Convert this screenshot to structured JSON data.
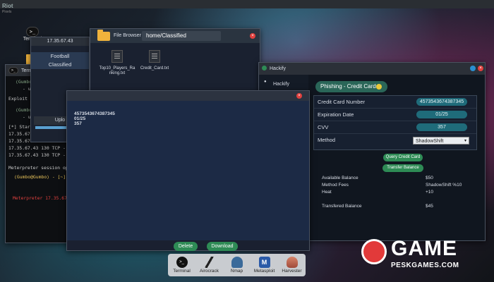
{
  "desktop": {
    "watermark_top": "Riot",
    "watermark_sub": "Pixels",
    "icons": [
      {
        "label": "Terminal"
      },
      {
        "label": "Terminal"
      }
    ]
  },
  "terminal": {
    "title": "Terminal",
    "lines": [
      "(Gumbo",
      "- use -x E",
      "Exploit not ava",
      "(Gumbo",
      "- use -x E",
      "[*] Started EternalBlue revers",
      "17.35.67.43 130 TCP - Built",
      "17.35.67.43 130 TCP - Overa",
      "17.35.67.43 130 TCP - Selec",
      "17.35.67.43 130 TCP - Exec",
      "Meterpreter session opened (",
      "(Gumbo@Gumbo) - [~]",
      "Meterpreter 17.35.67"
    ]
  },
  "ip_panel": {
    "ip": "17.35.67.43",
    "items": [
      "Football",
      "Classified"
    ],
    "upload_label": "Uplo"
  },
  "file_browser": {
    "title": "File Browser",
    "path": "home/Classified",
    "files": [
      {
        "name": "Top10_Players_Ra nking.txt"
      },
      {
        "name": "Credit_Card.txt"
      }
    ]
  },
  "hackify": {
    "title": "Hackify",
    "sidebar_item": "Hackify",
    "tab": "Phishing - Credit Cards",
    "form": {
      "rows": [
        {
          "label": "Credit Card Number",
          "value": "4573543674387345"
        },
        {
          "label": "Expiration Date",
          "value": "01/25"
        },
        {
          "label": "CVV",
          "value": "357"
        }
      ],
      "method_label": "Method",
      "method_value": "ShadowShift"
    },
    "buttons": {
      "query": "Query Credit Card",
      "transfer": "Transfer Balance"
    },
    "stats": {
      "available_label": "Available Balance",
      "available_value": "$50",
      "fees_label": "Method Fees",
      "fees_value": "ShadowShift %10",
      "heat_label": "Heat",
      "heat_value": "+10",
      "transferred_label": "Transfered Balance",
      "transferred_value": "$45"
    }
  },
  "message": {
    "lines": [
      "4573543674387345",
      "01/25",
      "357"
    ],
    "delete_label": "Delete",
    "download_label": "Download"
  },
  "dock": {
    "items": [
      "Terminal",
      "Airocrack",
      "Nmap",
      "Metasploit",
      "Harvester"
    ]
  },
  "game_watermark": {
    "brand": "GAME",
    "site": "PESKGAMES.COM"
  },
  "colors": {
    "accent_green": "#2e8b55",
    "pill_teal": "#1f6b7a",
    "close_red": "#e0403e",
    "phish_tab": "#2a6658"
  }
}
